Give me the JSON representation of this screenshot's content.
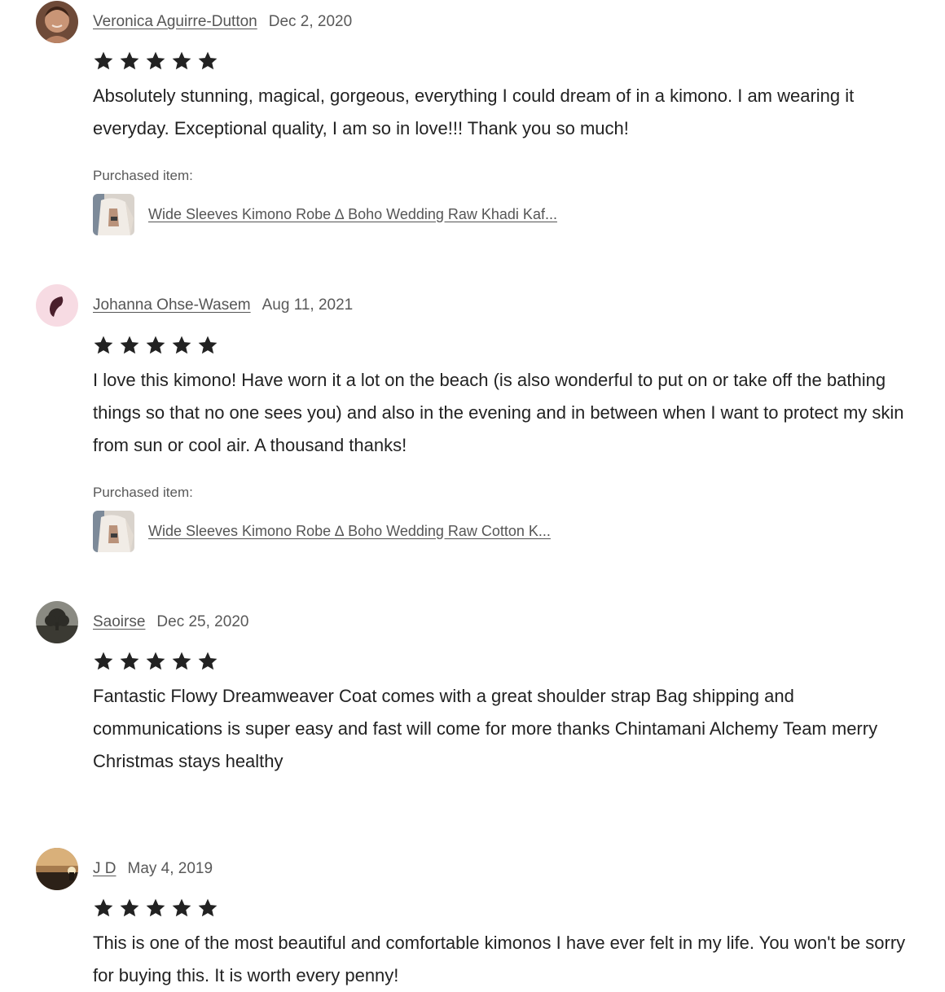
{
  "purchased_label": "Purchased item:",
  "star_color": "#222222",
  "reviews": [
    {
      "reviewer": "Veronica Aguirre-Dutton",
      "date": "Dec 2, 2020",
      "rating": 5,
      "text": "Absolutely stunning, magical, gorgeous, everything I could dream of in a kimono. I am wearing it everyday. Exceptional quality, I am so in love!!! Thank you so much!",
      "purchased_item": "Wide Sleeves Kimono Robe ∆ Boho Wedding Raw Khadi Kaf..."
    },
    {
      "reviewer": "Johanna Ohse-Wasem",
      "date": "Aug 11, 2021",
      "rating": 5,
      "text": "I love this kimono! Have worn it a lot on the beach (is also wonderful to put on or take off the bathing things so that no one sees you) and also in the evening and in between when I want to protect my skin from sun or cool air. A thousand thanks!",
      "purchased_item": "Wide Sleeves Kimono Robe ∆ Boho Wedding Raw Cotton K..."
    },
    {
      "reviewer": "Saoirse",
      "date": "Dec 25, 2020",
      "rating": 5,
      "text": "Fantastic Flowy Dreamweaver Coat comes with a great shoulder strap Bag shipping and communications is super easy and fast will come for more thanks Chintamani Alchemy Team merry Christmas stays healthy"
    },
    {
      "reviewer": "J D",
      "date": "May 4, 2019",
      "rating": 5,
      "text": "This is one of the most beautiful and comfortable kimonos I have ever felt in my life. You won't be sorry for buying this. It is worth every penny!"
    }
  ]
}
